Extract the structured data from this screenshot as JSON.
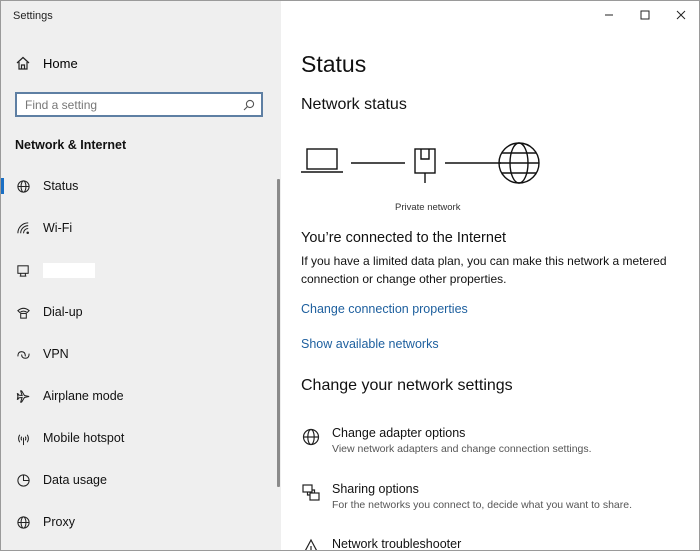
{
  "window": {
    "title": "Settings"
  },
  "sidebar": {
    "home_label": "Home",
    "search_placeholder": "Find a setting",
    "section_title": "Network & Internet",
    "items": [
      {
        "label": "Status",
        "icon": "status-globe-icon",
        "active": true
      },
      {
        "label": "Wi-Fi",
        "icon": "wifi-icon"
      },
      {
        "label": "",
        "icon": "ethernet-icon"
      },
      {
        "label": "Dial-up",
        "icon": "dialup-icon"
      },
      {
        "label": "VPN",
        "icon": "vpn-icon"
      },
      {
        "label": "Airplane mode",
        "icon": "airplane-icon"
      },
      {
        "label": "Mobile hotspot",
        "icon": "hotspot-icon"
      },
      {
        "label": "Data usage",
        "icon": "data-usage-icon"
      },
      {
        "label": "Proxy",
        "icon": "proxy-globe-icon"
      }
    ]
  },
  "main": {
    "title": "Status",
    "network_status_heading": "Network status",
    "diagram_label": "Private network",
    "connected_text": "You’re connected to the Internet",
    "description": "If you have a limited data plan, you can make this network a metered connection or change other properties.",
    "links": {
      "change_connection": "Change connection properties",
      "show_networks": "Show available networks"
    },
    "change_settings_heading": "Change your network settings",
    "options": [
      {
        "title": "Change adapter options",
        "description": "View network adapters and change connection settings.",
        "icon": "adapter-icon"
      },
      {
        "title": "Sharing options",
        "description": "For the networks you connect to, decide what you want to share.",
        "icon": "sharing-icon"
      },
      {
        "title": "Network troubleshooter",
        "description": "",
        "icon": "troubleshooter-icon"
      }
    ]
  },
  "colors": {
    "accent": "#1a6fc4",
    "link": "#1d5f9e",
    "sidebar_bg": "#efefef"
  }
}
